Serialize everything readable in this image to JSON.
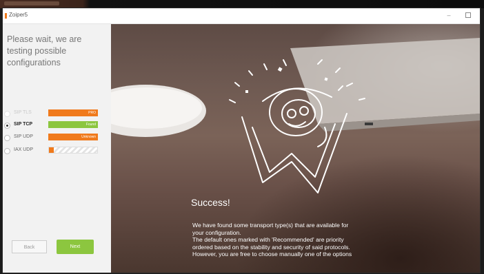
{
  "window": {
    "title": "Zoiper5",
    "minimize_glyph": "–"
  },
  "left": {
    "heading": "Please wait, we are testing possible configurations",
    "protocols": [
      {
        "label": "SIP TLS",
        "status": "PRO",
        "checked": false,
        "faded": true
      },
      {
        "label": "SIP TCP",
        "status": "Found",
        "checked": true,
        "faded": false
      },
      {
        "label": "SIP UDP",
        "status": "Unknown",
        "checked": false,
        "faded": false
      },
      {
        "label": "IAX UDP",
        "status": "",
        "progress": 0.1,
        "checked": false,
        "faded": false
      }
    ],
    "back_label": "Back",
    "next_label": "Next"
  },
  "right": {
    "success_title": "Success!",
    "lines": [
      "We have found some transport type(s) that are available for",
      "your configuration.",
      "The default ones marked with 'Recommended' are priority",
      "ordered based on the stability and security of said protocols.",
      "However, you are free to choose manually one of the options"
    ]
  },
  "colors": {
    "accent_orange": "#f07a1c",
    "accent_green": "#8cc63f"
  },
  "icons": [
    "zoiper-logo-icon",
    "window-minimize-icon",
    "window-maximize-icon",
    "radio-icon",
    "success-mascot-illustration"
  ]
}
